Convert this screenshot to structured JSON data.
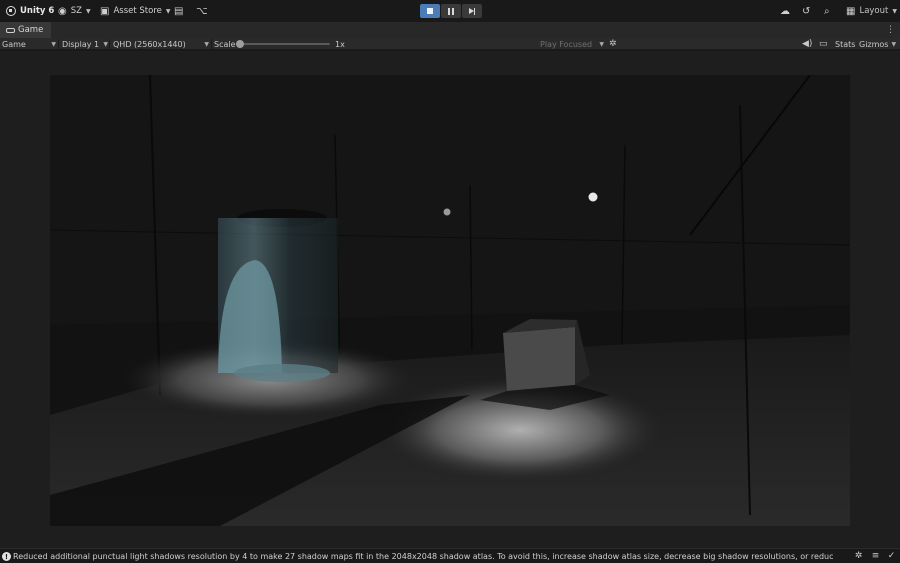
{
  "toolbar": {
    "app_label": "Unity 6",
    "account_label": "SZ",
    "asset_store_label": "Asset Store",
    "layout_label": "Layout"
  },
  "tabs": [
    {
      "label": "Game"
    }
  ],
  "game_bar": {
    "mode": "Game",
    "display": "Display 1",
    "resolution": "QHD (2560x1440)",
    "scale_label": "Scale",
    "scale_value": "1x",
    "play_focus": "Play Focused",
    "stats_label": "Stats",
    "gizmos_label": "Gizmos"
  },
  "play_controls": {
    "play_active": true
  },
  "status": {
    "message": "Reduced additional punctual light shadows resolution by 4 to make 27 shadow maps fit in the 2048x2048 shadow atlas. To avoid this, increase shadow atlas size, decrease big shadow resolutions, or reduce the number of shadow"
  },
  "icons": [
    "unity-logo-icon",
    "account-icon",
    "asset-store-icon",
    "package-icon",
    "version-control-icon",
    "stop-icon",
    "pause-icon",
    "step-icon",
    "cloud-icon",
    "history-icon",
    "search-icon",
    "layout-icon",
    "gamepad-icon",
    "kebab-menu-icon",
    "bug-icon",
    "audio-icon",
    "stats-icon",
    "warning-icon",
    "debug-icon",
    "console-icon",
    "check-icon"
  ],
  "colors": {
    "play_active": "#4a7cb8",
    "toolbar_bg": "#191919",
    "panel_bg": "#282828",
    "scene_bg": "#101010"
  }
}
